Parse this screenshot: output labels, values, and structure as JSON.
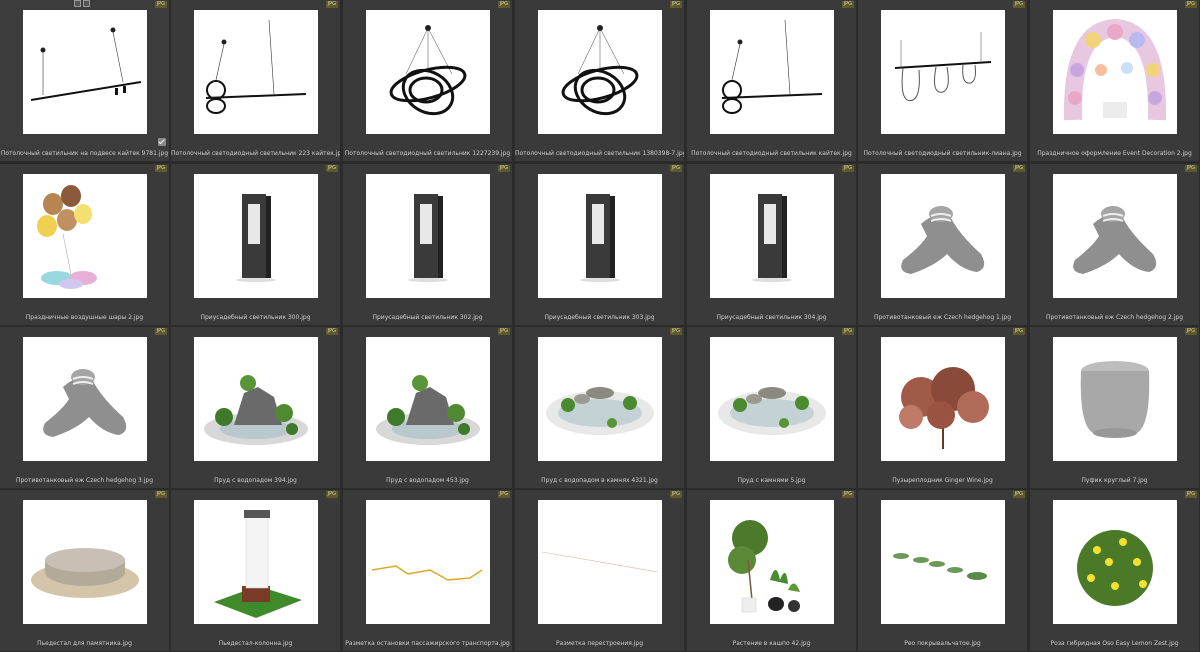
{
  "badge_text": "JPG",
  "items": [
    {
      "label": "Потолочный светильник на подвесе кайтек 9781.jpg",
      "icon": "pendant-linear-lamp-icon"
    },
    {
      "label": "Потолочный светодиодный светильник 223 кайтек.jpg",
      "icon": "pendant-ring-lamp-icon"
    },
    {
      "label": "Потолочный светодиодный светильник 1227239.jpg",
      "icon": "pendant-spiral-lamp-icon"
    },
    {
      "label": "Потолочный светодиодный светильник 1380398-7.jpg",
      "icon": "pendant-spiral-lamp-icon"
    },
    {
      "label": "Потолочный светодиодный светильник кайтек.jpg",
      "icon": "pendant-ring-lamp-icon"
    },
    {
      "label": "Потолочный светодиодный светильник-лиана.jpg",
      "icon": "pendant-liana-lamp-icon"
    },
    {
      "label": "Праздничное оформление Event Decoration 2.jpg",
      "icon": "balloon-arch-icon"
    },
    {
      "label": "Праздничные воздушные шары 2.jpg",
      "icon": "balloons-icon"
    },
    {
      "label": "Приусадебный светильник 300.jpg",
      "icon": "bollard-lamp-icon"
    },
    {
      "label": "Приусадебный светильник 302.jpg",
      "icon": "bollard-lamp-icon"
    },
    {
      "label": "Приусадебный светильник 303.jpg",
      "icon": "bollard-lamp-icon"
    },
    {
      "label": "Приусадебный светильник 304.jpg",
      "icon": "bollard-lamp-icon"
    },
    {
      "label": "Противотанковый еж Czech hedgehog 1.jpg",
      "icon": "concrete-tetrapod-icon"
    },
    {
      "label": "Противотанковый еж Czech hedgehog 2.jpg",
      "icon": "concrete-tetrapod-icon"
    },
    {
      "label": "Противотанковый еж Czech hedgehog 3.jpg",
      "icon": "concrete-tetrapod-icon"
    },
    {
      "label": "Пруд с водопадом 394.jpg",
      "icon": "pond-waterfall-icon"
    },
    {
      "label": "Пруд с водопадом 453.jpg",
      "icon": "pond-waterfall-icon"
    },
    {
      "label": "Пруд с водопадом в камнях 4321.jpg",
      "icon": "pond-stones-icon"
    },
    {
      "label": "Пруд с камнями 5.jpg",
      "icon": "pond-stones-icon"
    },
    {
      "label": "Пузыреплодник Ginger Wine.jpg",
      "icon": "shrub-icon"
    },
    {
      "label": "Пуфик круглый 7.jpg",
      "icon": "round-pouf-icon"
    },
    {
      "label": "Пьедестал для памятника.jpg",
      "icon": "round-pedestal-icon"
    },
    {
      "label": "Пьедестал-колонна.jpg",
      "icon": "column-pedestal-icon"
    },
    {
      "label": "Разметка остановки пассажирского транспорта.jpg",
      "icon": "zigzag-marking-icon"
    },
    {
      "label": "Разметка перестроения.jpg",
      "icon": "line-marking-icon"
    },
    {
      "label": "Растение в кашпо 42.jpg",
      "icon": "potted-plants-icon"
    },
    {
      "label": "Рео покрывальчатое.jpg",
      "icon": "ground-plants-icon"
    },
    {
      "label": "Роза гибридная Oso Easy Lemon Zest.jpg",
      "icon": "rose-bush-icon"
    }
  ]
}
